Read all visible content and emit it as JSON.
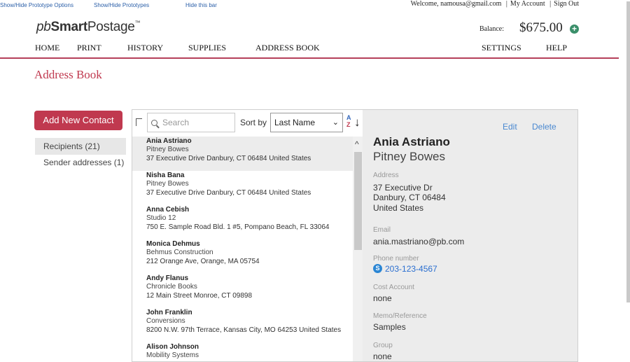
{
  "proto_bar": {
    "show_options": "Show/Hide Prototype Options",
    "show_prototypes": "Show/Hide Prototypes",
    "hide_bar": "Hide this bar"
  },
  "header": {
    "welcome": "Welcome, namousa@gmail.com",
    "my_account": "My Account",
    "sign_out": "Sign Out",
    "sep": "|",
    "logo_pb": "pb",
    "logo_smart": "Smart",
    "logo_postage": "Postage",
    "logo_tm": "™",
    "balance_label": "Balance:",
    "balance_value": "$675.00",
    "add_funds_glyph": "+"
  },
  "nav": {
    "items": [
      "HOME",
      "PRINT",
      "HISTORY",
      "SUPPLIES",
      "ADDRESS BOOK",
      "SETTINGS",
      "HELP"
    ]
  },
  "page": {
    "title": "Address Book",
    "add_contact_label": "Add New Contact",
    "filters": [
      {
        "label": "Recipients  (21)",
        "active": true
      },
      {
        "label": "Sender addresses  (1)",
        "active": false
      }
    ]
  },
  "list": {
    "search_placeholder": "Search",
    "sort_label": "Sort by",
    "sort_value": "Last Name",
    "sort_chevron": "⌄",
    "sort_a": "A",
    "sort_z": "Z",
    "sort_arrow": "↓",
    "scroll_up": "^",
    "contacts": [
      {
        "name": "Ania Astriano",
        "company": "Pitney Bowes",
        "address": "37 Executive Drive Danbury, CT 06484 United States",
        "selected": true
      },
      {
        "name": "Nisha Bana",
        "company": "Pitney Bowes",
        "address": "37 Executive Drive Danbury, CT 06484 United States",
        "selected": false
      },
      {
        "name": "Anna Cebish",
        "company": "Studio 12",
        "address": "750 E. Sample Road  Bld. 1  #5, Pompano Beach, FL 33064",
        "selected": false
      },
      {
        "name": "Monica Dehmus",
        "company": "Behmus Construction",
        "address": "212 Orange Ave, Orange, MA 05754",
        "selected": false
      },
      {
        "name": "Andy Flanus",
        "company": "Chronicle Books",
        "address": "12 Main Street Monroe, CT 09898",
        "selected": false
      },
      {
        "name": "John Franklin",
        "company": "Conversions",
        "address": "8200 N.W. 97th Terrace, Kansas City, MO 64253 United States",
        "selected": false
      },
      {
        "name": "Alison Johnson",
        "company": "Mobility Systems",
        "address": "",
        "selected": false
      }
    ]
  },
  "detail": {
    "edit_label": "Edit",
    "delete_label": "Delete",
    "name": "Ania Astriano",
    "company": "Pitney Bowes",
    "address_label": "Address",
    "address_line1": "37 Executive Dr",
    "address_line2": "Danbury, CT 06484",
    "address_line3": "United States",
    "email_label": "Email",
    "email": "ania.mastriano@pb.com",
    "phone_label": "Phone number",
    "phone": "203-123-4567",
    "skype_glyph": "S",
    "cost_account_label": "Cost Account",
    "cost_account": "none",
    "memo_label": "Memo/Reference",
    "memo": "Samples",
    "group_label": "Group",
    "group": "none"
  }
}
